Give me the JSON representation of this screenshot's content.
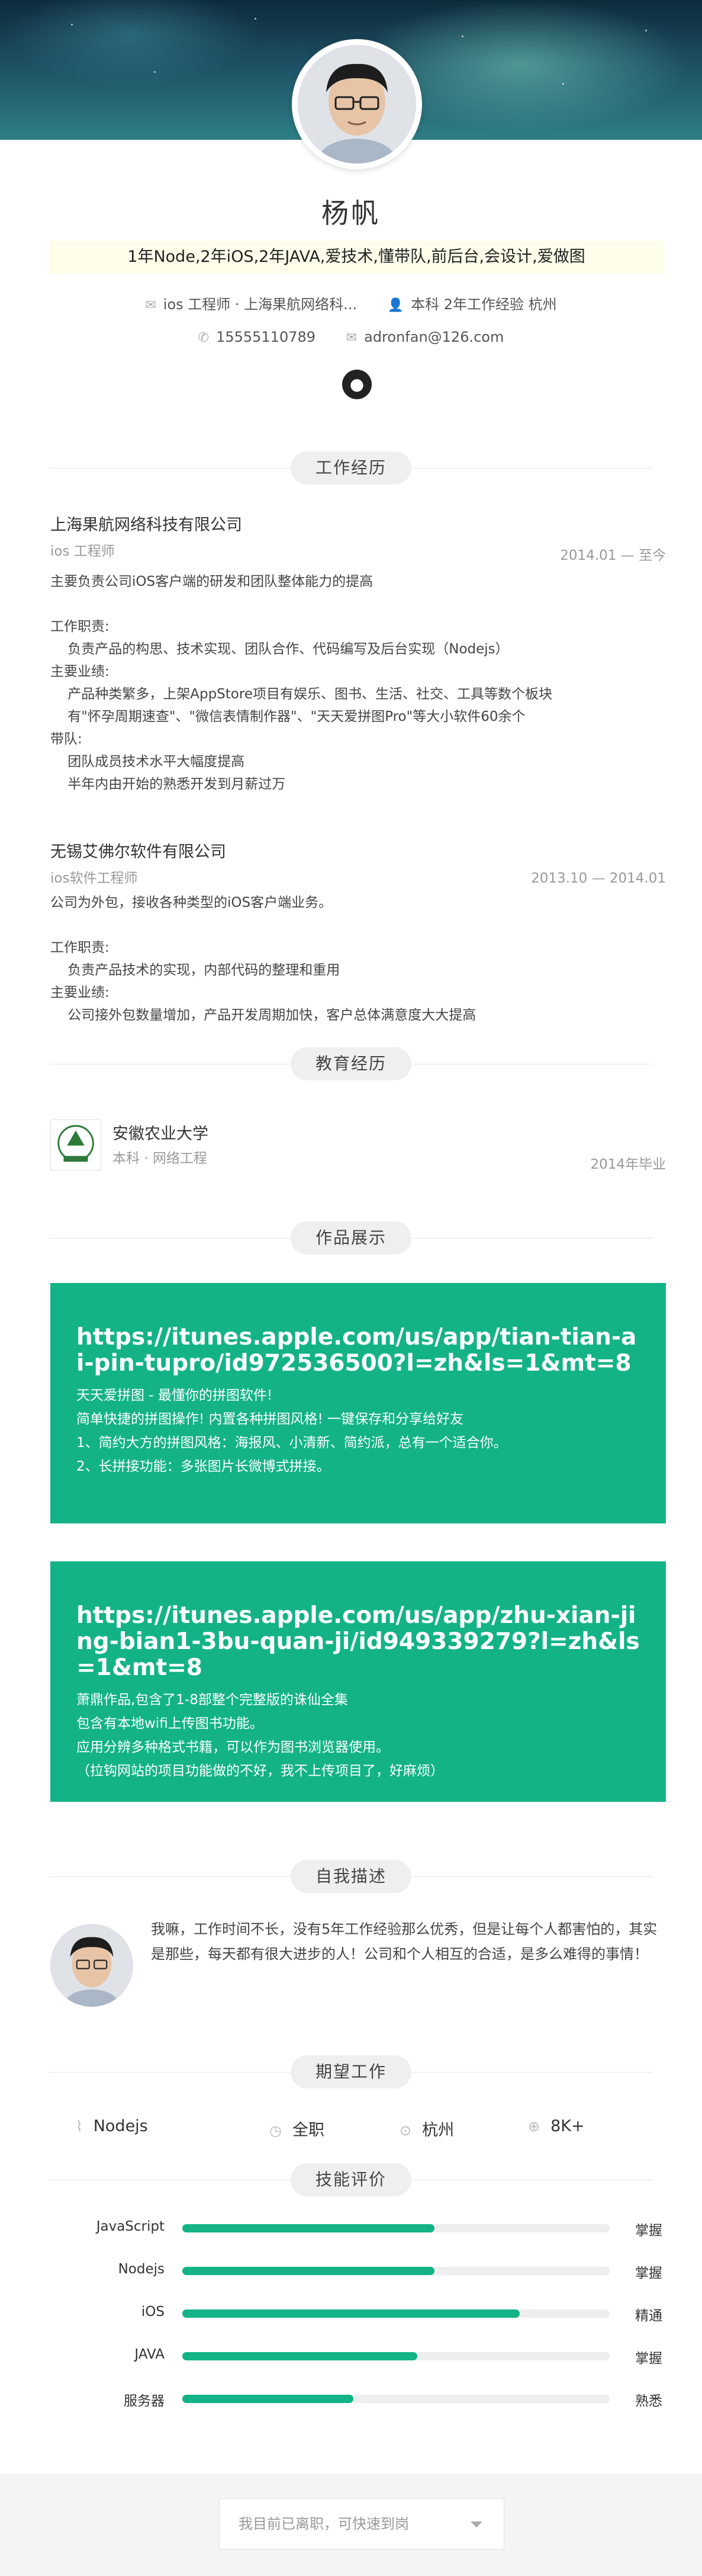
{
  "profile": {
    "name": "杨帆",
    "motto": "1年Node,2年iOS,2年JAVA,爱技术,懂带队,前后台,会设计,爱做图",
    "job_info": "ios 工程师 · 上海果航网络科...",
    "education_info": "本科  2年工作经验  杭州",
    "phone": "15555110789",
    "email": "adronfan@126.com"
  },
  "sections": {
    "work": "工作经历",
    "education": "教育经历",
    "works": "作品展示",
    "self": "自我描述",
    "expect": "期望工作",
    "skills": "技能评价"
  },
  "jobs": [
    {
      "company": "上海果航网络科技有限公司",
      "role": "ios 工程师",
      "period": "2014.01 — 至今",
      "desc": "主要负责公司iOS客户端的研发和团队整体能力的提高\n\n工作职责:\n    负责产品的构思、技术实现、团队合作、代码编写及后台实现（Nodejs）\n主要业绩:\n    产品种类繁多，上架AppStore项目有娱乐、图书、生活、社交、工具等数个板块\n    有\"怀孕周期速查\"、\"微信表情制作器\"、\"天天爱拼图Pro\"等大小软件60余个\n带队:\n    团队成员技术水平大幅度提高\n    半年内由开始的熟悉开发到月薪过万"
    },
    {
      "company": "无锡艾佛尔软件有限公司",
      "role": "ios软件工程师",
      "period": "2013.10 — 2014.01",
      "desc": "公司为外包，接收各种类型的iOS客户端业务。\n\n工作职责:\n    负责产品技术的实现，内部代码的整理和重用\n主要业绩:\n    公司接外包数量增加，产品开发周期加快，客户总体满意度大大提高"
    }
  ],
  "education": {
    "school": "安徽农业大学",
    "degree": "本科 · 网络工程",
    "period": "2014年毕业"
  },
  "works": [
    {
      "url": "https://itunes.apple.com/us/app/tian-tian-ai-pin-tupro/id972536500?l=zh&ls=1&mt=8",
      "lines": [
        "天天爱拼图 - 最懂你的拼图软件!",
        "简单快捷的拼图操作! 内置各种拼图风格! 一键保存和分享给好友",
        "1、简约大方的拼图风格：海报风、小清新、简约派，总有一个适合你。",
        "2、长拼接功能：多张图片长微博式拼接。"
      ]
    },
    {
      "url": "https://itunes.apple.com/us/app/zhu-xian-jing-bian1-3bu-quan-ji/id949339279?l=zh&ls=1&mt=8",
      "lines": [
        "萧鼎作品,包含了1-8部整个完整版的诛仙全集",
        "包含有本地wifi上传图书功能。",
        "应用分辨多种格式书籍，可以作为图书浏览器使用。",
        "（拉钩网站的项目功能做的不好，我不上传项目了，好麻烦）"
      ]
    }
  ],
  "self_desc": "我嘛，工作时间不长，没有5年工作经验那么优秀，但是让每个人都害怕的，其实是那些，每天都有很大进步的人！公司和个人相互的合适，是多么难得的事情！",
  "expect": {
    "position": "Nodejs",
    "type": "全职",
    "city": "杭州",
    "salary": "8K+"
  },
  "skills": [
    {
      "name": "JavaScript",
      "level": "掌握",
      "value": 0.59
    },
    {
      "name": "Nodejs",
      "level": "掌握",
      "value": 0.59
    },
    {
      "name": "iOS",
      "level": "精通",
      "value": 0.79
    },
    {
      "name": "JAVA",
      "level": "掌握",
      "value": 0.55
    },
    {
      "name": "服务器",
      "level": "熟悉",
      "value": 0.4
    }
  ],
  "footer": {
    "status": "我目前已离职，可快速到岗"
  },
  "colors": {
    "accent": "#13b387",
    "motto_bg": "#fdfde9"
  }
}
